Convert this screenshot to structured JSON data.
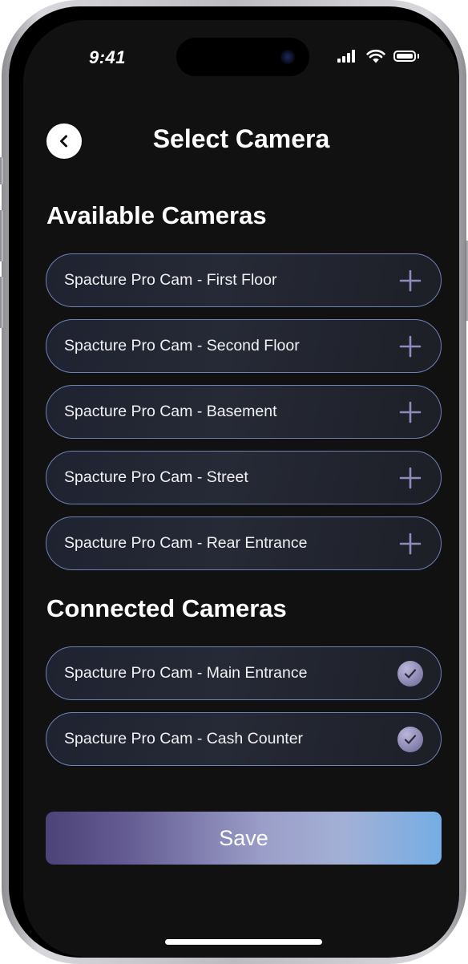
{
  "status_bar": {
    "time": "9:41"
  },
  "header": {
    "title": "Select Camera",
    "back_icon": "chevron-left-icon"
  },
  "available": {
    "title": "Available Cameras",
    "action_icon": "plus-icon",
    "items": [
      {
        "label": "Spacture Pro Cam - First Floor"
      },
      {
        "label": "Spacture Pro Cam - Second Floor"
      },
      {
        "label": "Spacture Pro Cam - Basement"
      },
      {
        "label": "Spacture Pro Cam - Street"
      },
      {
        "label": "Spacture Pro Cam - Rear Entrance"
      }
    ]
  },
  "connected": {
    "title": "Connected Cameras",
    "status_icon": "checkmark-icon",
    "items": [
      {
        "label": "Spacture Pro Cam - Main Entrance"
      },
      {
        "label": "Spacture Pro Cam - Cash Counter"
      }
    ]
  },
  "save_label": "Save",
  "colors": {
    "background": "#111112",
    "row_border": "#6f80b3",
    "save_gradient_start": "#4c4478",
    "save_gradient_end": "#74aee4",
    "check_badge": "#8f8bb6"
  }
}
